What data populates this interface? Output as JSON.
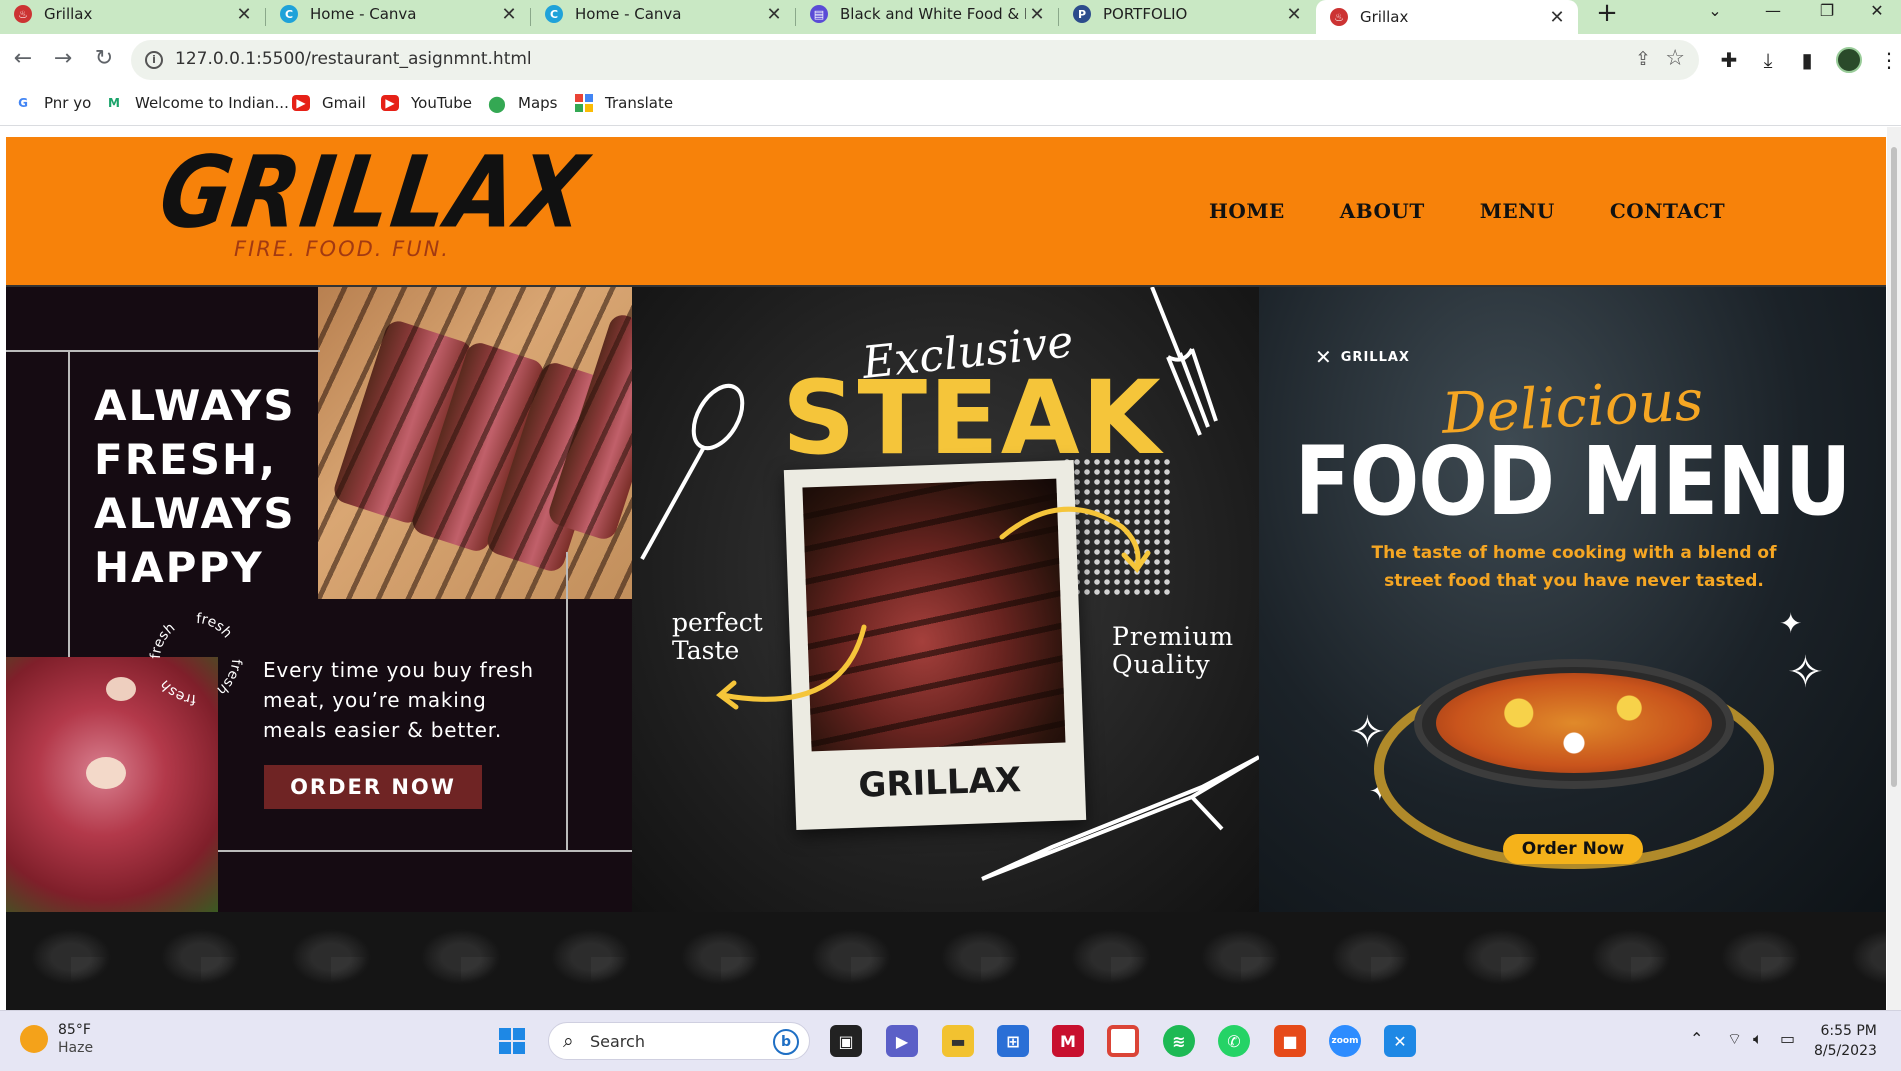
{
  "browser": {
    "tabs": [
      {
        "title": "Grillax",
        "favicon": "grill-icon",
        "active": false
      },
      {
        "title": "Home - Canva",
        "favicon": "canva-icon",
        "active": false
      },
      {
        "title": "Home - Canva",
        "favicon": "canva-icon",
        "active": false
      },
      {
        "title": "Black and White Food & Be",
        "favicon": "doc-icon",
        "active": false
      },
      {
        "title": "PORTFOLIO",
        "favicon": "portfolio-icon",
        "active": false
      },
      {
        "title": "Grillax",
        "favicon": "grill-icon",
        "active": true
      }
    ],
    "url": "127.0.0.1:5500/restaurant_asignmnt.html",
    "bookmarks": [
      {
        "label": "Pnr yo",
        "icon": "google-icon",
        "color": "#4285f4"
      },
      {
        "label": "Welcome to Indian...",
        "icon": "indian-rail-icon",
        "color": "#1aa36a"
      },
      {
        "label": "Gmail",
        "icon": "youtube-icon",
        "color": "#e62117"
      },
      {
        "label": "YouTube",
        "icon": "youtube-icon",
        "color": "#e62117"
      },
      {
        "label": "Maps",
        "icon": "maps-pin-icon",
        "color": "#34a853"
      },
      {
        "label": "Translate",
        "icon": "translate-icon",
        "color": "#fbbc05"
      }
    ]
  },
  "site": {
    "logo": {
      "name": "GRILLAX",
      "tagline": "FIRE. FOOD. FUN."
    },
    "nav": [
      "HOME",
      "ABOUT",
      "MENU",
      "CONTACT"
    ],
    "brand_color": "#f7820a",
    "panel1": {
      "title_lines": [
        "ALWAYS",
        "FRESH,",
        "ALWAYS",
        "HAPPY"
      ],
      "badge_words": [
        "fresh",
        "fresh",
        "fresh",
        "fresh"
      ],
      "body_lines": [
        "Every time you buy fresh",
        "meat, you’re making",
        "meals easier & better."
      ],
      "button": "ORDER NOW"
    },
    "panel2": {
      "script_title": "Exclusive",
      "title": "STEAK",
      "polaroid_label": "GRILLAX",
      "left_note": [
        "perfect",
        "Taste"
      ],
      "right_note": [
        "Premium",
        "Quality"
      ]
    },
    "panel3": {
      "brand": "GRILLAX",
      "script_title": "Delicious",
      "title": "FOOD MENU",
      "tagline": "The taste of home cooking with a blend of street food that you have never tasted.",
      "button": "Order Now"
    }
  },
  "taskbar": {
    "weather": {
      "temp": "85°F",
      "desc": "Haze"
    },
    "search_placeholder": "Search",
    "apps": [
      "windows-start-icon",
      "file-manager-icon",
      "teams-icon",
      "explorer-icon",
      "store-icon",
      "mcafee-icon",
      "chrome-icon",
      "spotify-icon",
      "whatsapp-icon",
      "camera-icon",
      "zoom-icon",
      "vscode-icon"
    ],
    "time": "6:55 PM",
    "date": "8/5/2023"
  }
}
